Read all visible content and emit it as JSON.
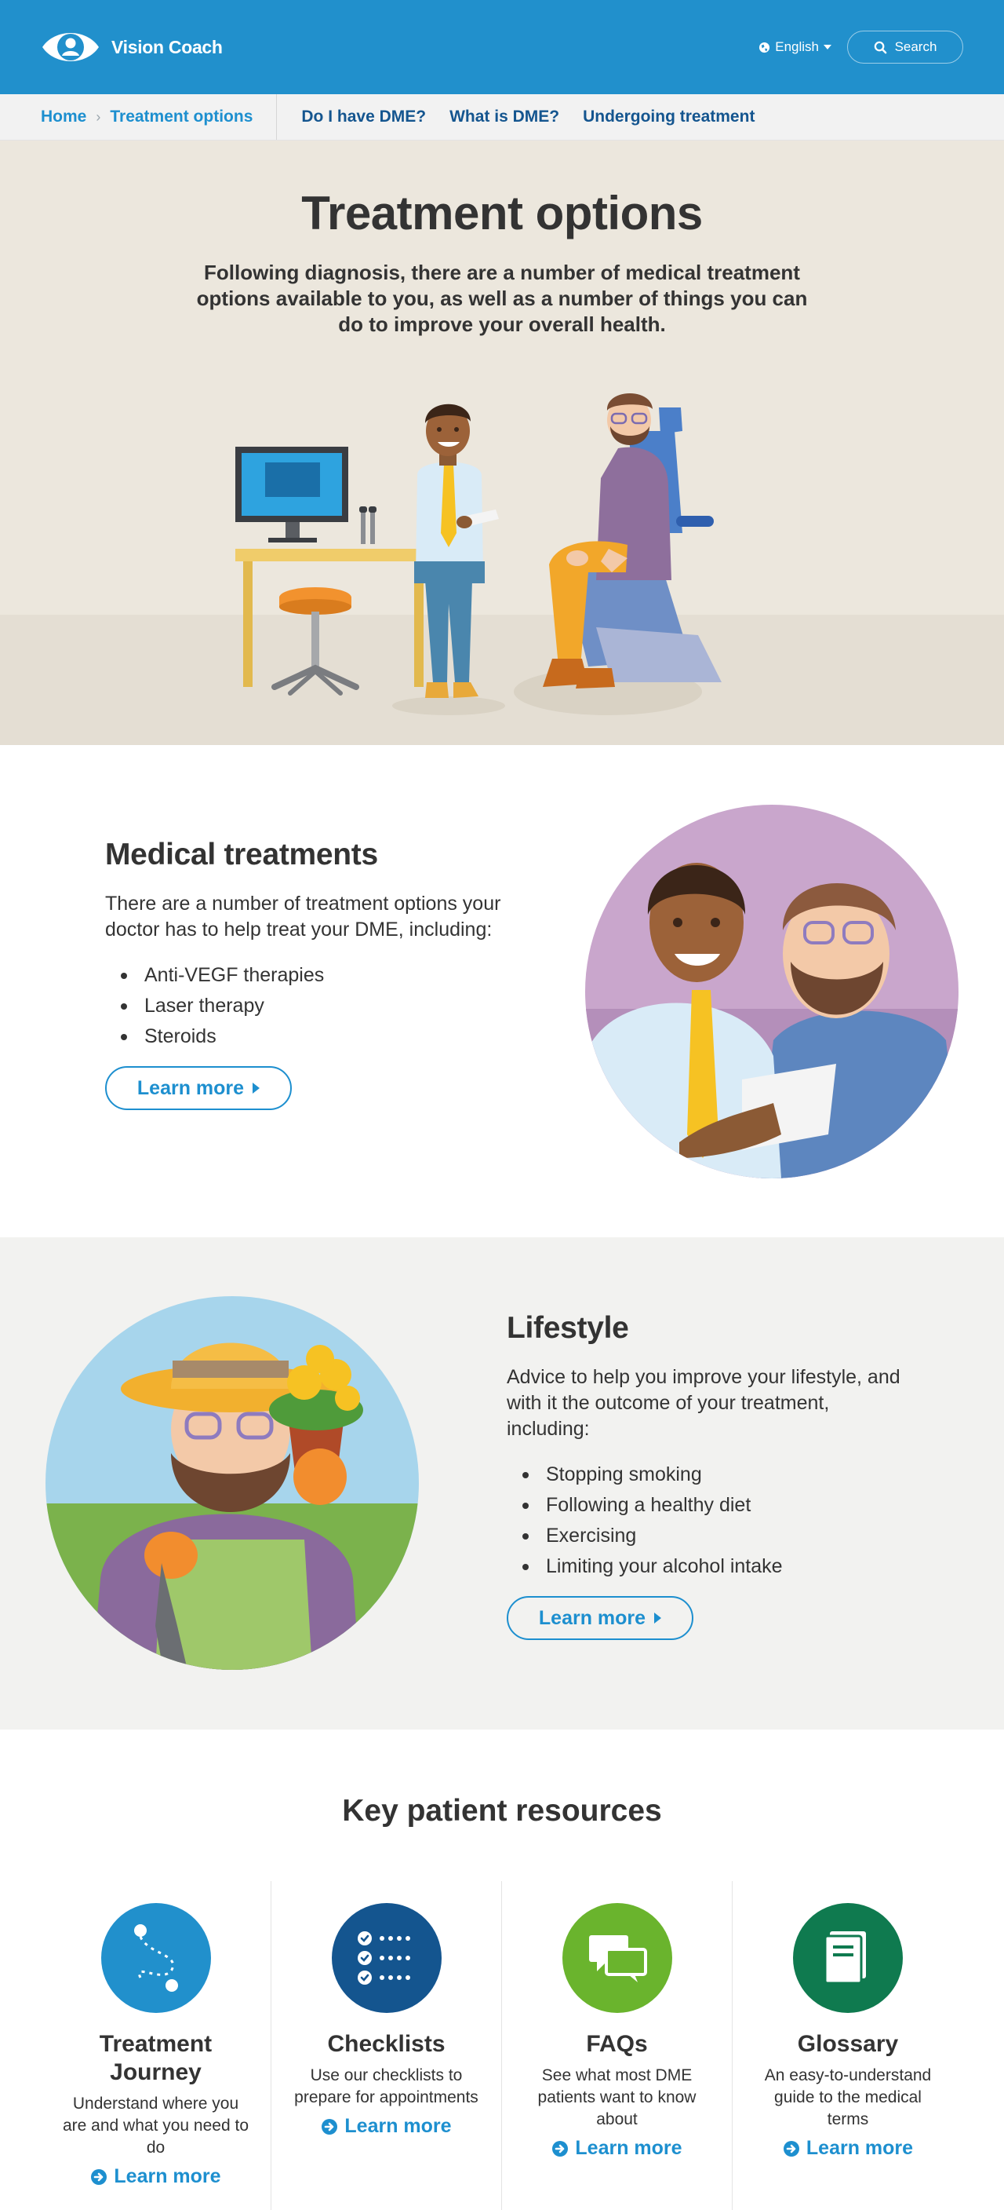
{
  "header": {
    "brand": "Vision Coach",
    "language": "English",
    "search_label": "Search"
  },
  "nav": {
    "breadcrumb": [
      "Home",
      "Treatment options"
    ],
    "links": [
      "Do I have DME?",
      "What is DME?",
      "Undergoing treatment"
    ]
  },
  "hero": {
    "title": "Treatment options",
    "intro": "Following diagnosis, there are a number of medical treatment options available to you, as well as a number of things you can do to improve your overall health."
  },
  "medical": {
    "title": "Medical treatments",
    "body": "There are a number of treatment options your doctor has to help treat your DME, including:",
    "items": [
      "Anti-VEGF therapies",
      "Laser therapy",
      "Steroids"
    ],
    "button": "Learn more"
  },
  "lifestyle": {
    "title": "Lifestyle",
    "body": "Advice to help you improve your lifestyle, and with it the outcome of your treatment, including:",
    "items": [
      "Stopping smoking",
      "Following a healthy diet",
      "Exercising",
      "Limiting your alcohol intake"
    ],
    "button": "Learn more"
  },
  "resources": {
    "title": "Key patient resources",
    "cards": [
      {
        "title": "Treatment Journey",
        "desc": "Understand where you are and what you need to do",
        "link": "Learn more",
        "icon": "journey-icon",
        "color": "#2190cc"
      },
      {
        "title": "Checklists",
        "desc": "Use our checklists to prepare for appointments",
        "link": "Learn more",
        "icon": "checklist-icon",
        "color": "#14558f"
      },
      {
        "title": "FAQs",
        "desc": "See what most DME patients want to know about",
        "link": "Learn more",
        "icon": "chat-bubbles-icon",
        "color": "#6ab42d"
      },
      {
        "title": "Glossary",
        "desc": "An easy-to-understand guide to the medical terms",
        "link": "Learn more",
        "icon": "book-icon",
        "color": "#0f7a4f"
      }
    ]
  },
  "colors": {
    "primary": "#2190cc",
    "dark_blue": "#14558f",
    "hero_bg": "#ece7dd",
    "section_alt_bg": "#f2f2f0"
  }
}
